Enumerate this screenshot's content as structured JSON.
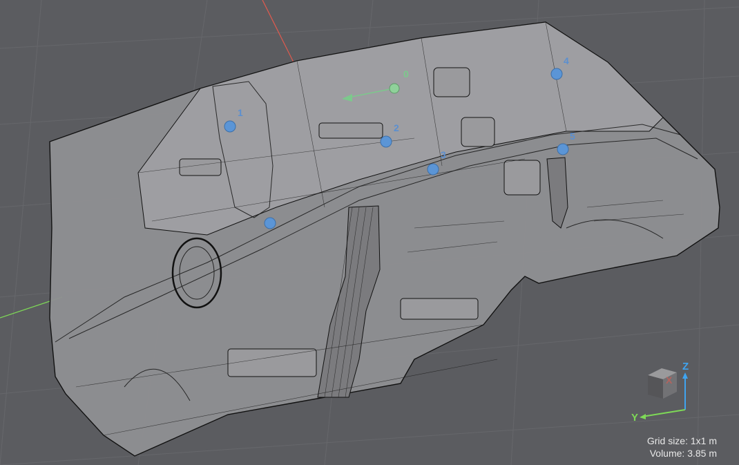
{
  "scene": {
    "markers": [
      {
        "label": "0",
        "type": "origin"
      },
      {
        "label": "1",
        "type": "point"
      },
      {
        "label": "2",
        "type": "point"
      },
      {
        "label": "3",
        "type": "point"
      },
      {
        "label": "4",
        "type": "point"
      },
      {
        "label": "5",
        "type": "point"
      }
    ],
    "colors": {
      "background": "#5b5c60",
      "marker_blue": "#5b95d6",
      "marker_green": "#8fd19a",
      "axis_x": "#e05a4e",
      "axis_y": "#7ed957",
      "axis_z": "#3fa4f0"
    }
  },
  "gizmo": {
    "axis_x": "X",
    "axis_y": "Y",
    "axis_z": "Z"
  },
  "info": {
    "grid_size": "Grid size: 1x1 m",
    "volume": "Volume: 3.85 m"
  }
}
